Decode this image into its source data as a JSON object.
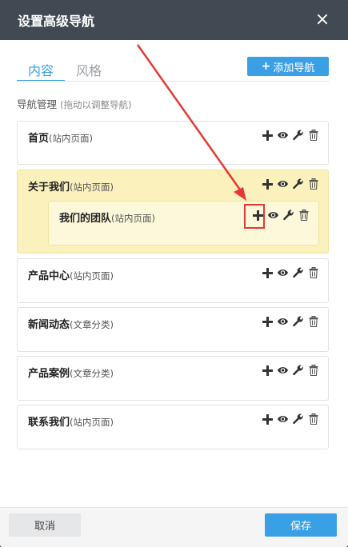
{
  "dialog": {
    "title": "设置高级导航",
    "close_symbol": "×"
  },
  "tabs": [
    {
      "label": "内容",
      "active": true
    },
    {
      "label": "风格",
      "active": false
    }
  ],
  "add_nav_button": {
    "icon": "+",
    "label": "添加导航"
  },
  "section": {
    "title": "导航管理",
    "hint": "(拖动以调整导航)"
  },
  "nav_items": [
    {
      "name": "首页",
      "type": "(站内页面)"
    },
    {
      "name": "关于我们",
      "type": "(站内页面)",
      "highlighted": true,
      "children": [
        {
          "name": "我们的团队",
          "type": "(站内页面)"
        }
      ]
    },
    {
      "name": "产品中心",
      "type": "(站内页面)"
    },
    {
      "name": "新闻动态",
      "type": "(文章分类)"
    },
    {
      "name": "产品案例",
      "type": "(文章分类)"
    },
    {
      "name": "联系我们",
      "type": "(站内页面)"
    }
  ],
  "item_actions": [
    "plus-icon",
    "eye-icon",
    "wrench-icon",
    "trash-icon"
  ],
  "footer": {
    "cancel_label": "取消",
    "save_label": "保存"
  },
  "colors": {
    "titlebar": "#414a52",
    "accent": "#3aa0e6",
    "highlight": "#fbf1bd",
    "annotation": "#e53935"
  }
}
